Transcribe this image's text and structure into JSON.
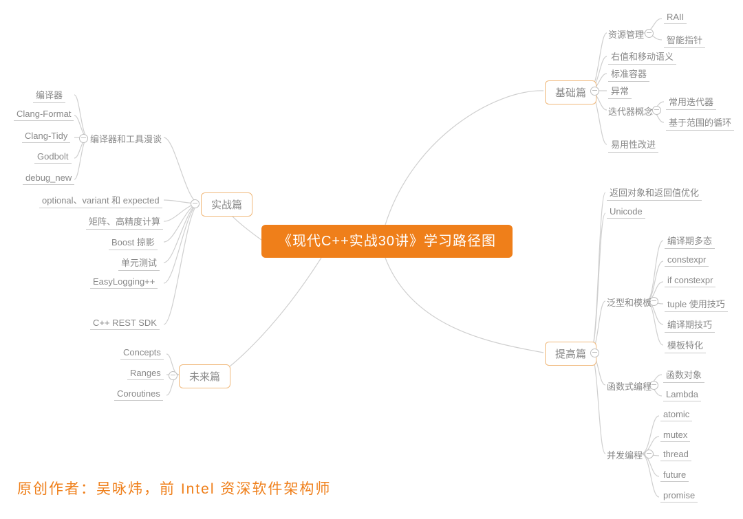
{
  "center": {
    "title": "《现代C++实战30讲》学习路径图"
  },
  "author": "原创作者：吴咏炜，前 Intel 资深软件架构师",
  "branches": {
    "basics": {
      "label": "基础篇"
    },
    "practice": {
      "label": "实战篇"
    },
    "advanced": {
      "label": "提高篇"
    },
    "future": {
      "label": "未来篇"
    }
  },
  "basics": {
    "resource_mgmt": {
      "label": "资源管理",
      "raii": "RAII",
      "smart_ptr": "智能指针"
    },
    "rvalue": "右值和移动语义",
    "container": "标准容器",
    "exception": "异常",
    "iterator": {
      "label": "迭代器概念",
      "common": "常用迭代器",
      "range_for": "基于范围的循环"
    },
    "usability": "易用性改进"
  },
  "practice": {
    "tools": {
      "label": "编译器和工具漫谈",
      "compiler": "编译器",
      "clang_format": "Clang-Format",
      "clang_tidy": "Clang-Tidy",
      "godbolt": "Godbolt",
      "debug_new": "debug_new"
    },
    "optional": "optional、variant 和 expected",
    "matrix": "矩阵、高精度计算",
    "boost": "Boost 掠影",
    "unittest": "单元测试",
    "easylog": "EasyLogging++",
    "restsdk": "C++ REST SDK"
  },
  "advanced": {
    "retobj": "返回对象和返回值优化",
    "unicode": "Unicode",
    "generics": {
      "label": "泛型和模板",
      "poly": "编译期多态",
      "constexpr": "constexpr",
      "if_constexpr": "if constexpr",
      "tuple": "tuple 使用技巧",
      "compile_tricks": "编译期技巧",
      "spec": "模板特化"
    },
    "functional": {
      "label": "函数式编程",
      "funcobj": "函数对象",
      "lambda": "Lambda"
    },
    "concurrency": {
      "label": "并发编程",
      "atomic": "atomic",
      "mutex": "mutex",
      "thread": "thread",
      "future": "future",
      "promise": "promise"
    }
  },
  "future_items": {
    "concepts": "Concepts",
    "ranges": "Ranges",
    "coroutines": "Coroutines"
  }
}
